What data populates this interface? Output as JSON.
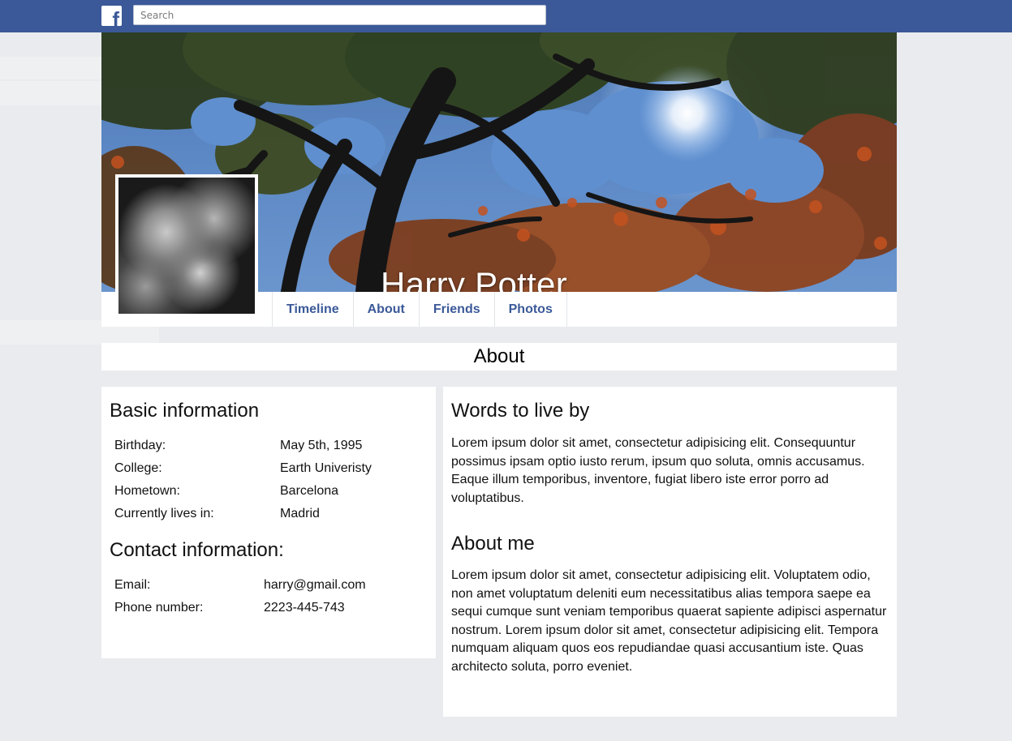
{
  "header": {
    "logo_letter": "f",
    "search": {
      "placeholder": "Search",
      "value": ""
    },
    "brand_color": "#3b5998"
  },
  "profile": {
    "name": "Harry Potter",
    "cover_icon": "cover-photo",
    "avatar_icon": "profile-picture"
  },
  "nav": {
    "tabs": [
      "Timeline",
      "About",
      "Friends",
      "Photos"
    ]
  },
  "about_header": "About",
  "basic_info": {
    "title": "Basic information",
    "rows": [
      {
        "label": "Birthday:",
        "value": "May 5th, 1995"
      },
      {
        "label": "College:",
        "value": "Earth Univeristy"
      },
      {
        "label": "Hometown:",
        "value": "Barcelona"
      },
      {
        "label": "Currently lives in:",
        "value": "Madrid"
      }
    ]
  },
  "contact_info": {
    "title": "Contact information:",
    "rows": [
      {
        "label": "Email:",
        "value": "harry@gmail.com"
      },
      {
        "label": "Phone number:",
        "value": "2223-445-743"
      }
    ]
  },
  "words": {
    "title": "Words to live by",
    "text": "Lorem ipsum dolor sit amet, consectetur adipisicing elit. Consequuntur possimus ipsam optio iusto rerum, ipsum quo soluta, omnis accusamus. Eaque illum temporibus, inventore, fugiat libero iste error porro ad voluptatibus."
  },
  "about_me": {
    "title": "About me",
    "text": "Lorem ipsum dolor sit amet, consectetur adipisicing elit. Voluptatem odio, non amet voluptatum deleniti eum necessitatibus alias tempora saepe ea sequi cumque sunt veniam temporibus quaerat sapiente adipisci aspernatur nostrum. Lorem ipsum dolor sit amet, consectetur adipisicing elit. Tempora numquam aliquam quos eos repudiandae quasi accusantium iste. Quas architecto soluta, porro eveniet."
  }
}
